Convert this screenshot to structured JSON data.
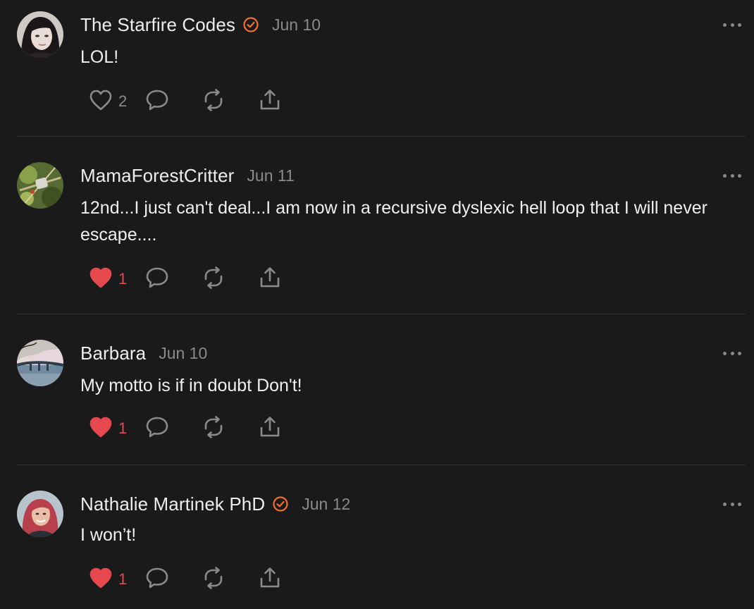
{
  "colors": {
    "background": "#1a1a1b",
    "verified_accent": "#f0712c",
    "liked": "#e5484d",
    "muted": "#8a8a8c"
  },
  "comments": [
    {
      "author": "The Starfire Codes",
      "verified": true,
      "date": "Jun 10",
      "text": "LOL!",
      "likes": "2",
      "liked": false
    },
    {
      "author": "MamaForestCritter",
      "verified": false,
      "date": "Jun 11",
      "text": "12nd...I just can't deal...I am now in a recursive dyslexic hell loop that I will never escape....",
      "likes": "1",
      "liked": true
    },
    {
      "author": "Barbara",
      "verified": false,
      "date": "Jun 10",
      "text": "My motto is if in doubt Don't!",
      "likes": "1",
      "liked": true
    },
    {
      "author": "Nathalie Martinek PhD",
      "verified": true,
      "date": "Jun 12",
      "text": "I won’t!",
      "likes": "1",
      "liked": true
    }
  ],
  "icons": {
    "verified": "verified-check-icon",
    "like": "heart-icon",
    "reply": "speech-bubble-icon",
    "restack": "restack-arrows-icon",
    "share": "share-upload-icon",
    "more": "more-dots-icon"
  }
}
